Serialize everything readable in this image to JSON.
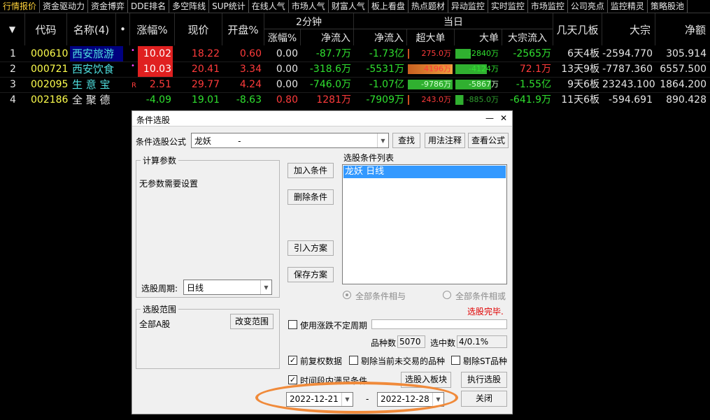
{
  "tabs": [
    "行情报价",
    "资金驱动力",
    "资金博弈",
    "DDE排名",
    "多空阵线",
    "SUP统计",
    "在线人气",
    "市场人气",
    "财富人气",
    "板上看盘",
    "热点题材",
    "异动监控",
    "实时监控",
    "市场监控",
    "公司亮点",
    "监控精灵",
    "策略股池"
  ],
  "header": {
    "sort_arrow": "▼",
    "code": "代码",
    "name": "名称(4)",
    "dot": "•",
    "change_pct": "涨幅%",
    "price": "现价",
    "open_pct": "开盘%",
    "two_min": "2分钟",
    "today": "当日",
    "two_min_change": "涨幅%",
    "two_min_inflow": "净流入",
    "net_inflow": "净流入",
    "super_large": "超大单",
    "large": "大单",
    "block_inflow": "大宗流入",
    "days_boards": "几天几板",
    "block": "大宗",
    "net_amount": "净额"
  },
  "rows": [
    {
      "idx": "1",
      "code": "000610",
      "name": "西安旅游",
      "flag": "•",
      "change": "10.02",
      "price": "18.22",
      "open": "0.60",
      "chg2": "0.00",
      "inflow2": "-87.7万",
      "net": "-1.73亿",
      "super": "275.0万",
      "large": "-2840万",
      "blockin": "-2565万",
      "days": "6天4板",
      "block": "-2594.770",
      "netamt": "305.914"
    },
    {
      "idx": "2",
      "code": "000721",
      "name": "西安饮食",
      "flag": "•",
      "change": "10.03",
      "price": "20.41",
      "open": "3.34",
      "chg2": "0.00",
      "inflow2": "-318.6万",
      "net": "-5531万",
      "super": "4196万",
      "large": "-4124万",
      "blockin": "72.1万",
      "days": "13天9板",
      "block": "-7787.360",
      "netamt": "6557.500"
    },
    {
      "idx": "3",
      "code": "002095",
      "name": "生 意 宝",
      "flag": "R",
      "change": "2.51",
      "price": "29.77",
      "open": "4.24",
      "chg2": "0.00",
      "inflow2": "-746.0万",
      "net": "-1.07亿",
      "super": "-9786万",
      "large": "-5867万",
      "blockin": "-1.55亿",
      "days": "9天6板",
      "block": "23243.100",
      "netamt": "1864.200"
    },
    {
      "idx": "4",
      "code": "002186",
      "name": "全 聚 德",
      "flag": "",
      "change": "-4.09",
      "price": "19.01",
      "open": "-8.63",
      "chg2": "0.80",
      "inflow2": "1281万",
      "net": "-7909万",
      "super": "243.0万",
      "large": "-885.0万",
      "blockin": "-641.9万",
      "days": "11天6板",
      "block": "-594.691",
      "netamt": "890.428"
    }
  ],
  "dialog": {
    "title": "条件选股",
    "minimize": "—",
    "close": "✕",
    "formula_label": "条件选股公式",
    "formula_value": "龙妖          -",
    "find_btn": "查找",
    "usage_btn": "用法注释",
    "view_btn": "查看公式",
    "calc_params_title": "计算参数",
    "no_params": "无参数需要设置",
    "period_label": "选股周期:",
    "period_value": "日线",
    "add_cond": "加入条件",
    "del_cond": "删除条件",
    "import_plan": "引入方案",
    "save_plan": "保存方案",
    "cond_list_title": "选股条件列表",
    "cond_item": "龙妖  日线",
    "all_and": "全部条件相与",
    "all_or": "全部条件相或",
    "done_text": "选股完毕.",
    "range_title": "选股范围",
    "range_value": "全部A股",
    "change_range": "改变范围",
    "use_period": "使用涨跌不定周期",
    "count_label": "品种数",
    "count_value": "5070",
    "selected_label": "选中数",
    "selected_value": "4/0.1%",
    "adj_data": "前复权数据",
    "exclude_untraded": "剔除当前未交易的品种",
    "exclude_st": "剔除ST品种",
    "time_range": "时间段内满足条件",
    "to_block": "选股入板块",
    "run": "执行选股",
    "close_btn": "关闭",
    "date_from": "2022-12-21",
    "date_sep": "-",
    "date_to": "2022-12-28"
  },
  "colors": {
    "highlight_circle": "#f08a3a",
    "selection": "#3399ff",
    "limit_up": "#e02020"
  }
}
